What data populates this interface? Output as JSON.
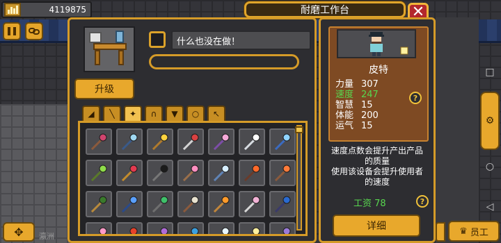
{
  "topbar": {
    "money": "4119875"
  },
  "title": "耐磨工作台",
  "icons": {
    "money": "money-building-icon",
    "pause": "pause-icon",
    "link": "chain-link-icon",
    "close": "close-icon",
    "help": "question-icon",
    "dpad": "move-arrows-icon",
    "staff": "crown-icon",
    "knob": "gear-icon"
  },
  "station": {
    "upgrade_label": "升级",
    "status_text": "什么也没在做！",
    "progress": 0
  },
  "tabs": [
    {
      "name": "tab-wedge",
      "glyph": "◢"
    },
    {
      "name": "tab-stick",
      "glyph": "╲"
    },
    {
      "name": "tab-wand",
      "glyph": "✦"
    },
    {
      "name": "tab-helmet",
      "glyph": "∩"
    },
    {
      "name": "tab-armor",
      "glyph": "▼"
    },
    {
      "name": "tab-ring",
      "glyph": "○"
    },
    {
      "name": "tab-pickaxe",
      "glyph": "↖"
    }
  ],
  "active_tab": 2,
  "items": [
    {
      "name": "red-cane-icon",
      "shaft": "#8b5a3c",
      "head": "#d0446e"
    },
    {
      "name": "crystal-wand-icon",
      "shaft": "#3a5a8a",
      "head": "#9fd8f2"
    },
    {
      "name": "gold-orb-staff-icon",
      "shaft": "#b07a2c",
      "head": "#ffd33f"
    },
    {
      "name": "red-orb-wand-icon",
      "shaft": "#d4d4d4",
      "head": "#d94141"
    },
    {
      "name": "pink-crystal-wand-icon",
      "shaft": "#7d4da8",
      "head": "#f5a9d8"
    },
    {
      "name": "silver-rod-icon",
      "shaft": "#d8dde2",
      "head": "#ffffff"
    },
    {
      "name": "blue-gem-wand-icon",
      "shaft": "#3b6bc1",
      "head": "#8fd3ff"
    },
    {
      "name": "green-leaf-staff-icon",
      "shaft": "#5a7a2a",
      "head": "#8fdc4a"
    },
    {
      "name": "ruby-star-staff-icon",
      "shaft": "#c28b2c",
      "head": "#e23a4f"
    },
    {
      "name": "black-orb-rod-icon",
      "shaft": "#777777",
      "head": "#1b1b1b"
    },
    {
      "name": "pink-heart-wand-icon",
      "shaft": "#9a6f4a",
      "head": "#ff8fc1"
    },
    {
      "name": "ice-axe-wand-icon",
      "shaft": "#5f83b5",
      "head": "#d6eeff"
    },
    {
      "name": "fire-ring-staff-icon",
      "shaft": "#6a3b2a",
      "head": "#ff6a2a"
    },
    {
      "name": "flame-mace-icon",
      "shaft": "#8b5a3c",
      "head": "#ff7b3a"
    },
    {
      "name": "thorn-staff-icon",
      "shaft": "#b88a3c",
      "head": "#3a7a2c"
    },
    {
      "name": "sapphire-rod-icon",
      "shaft": "#2a4a8a",
      "head": "#5aa0ff"
    },
    {
      "name": "emerald-mace-icon",
      "shaft": "#6f6f6f",
      "head": "#3fc06a"
    },
    {
      "name": "skull-staff-icon",
      "shaft": "#8b5a3c",
      "head": "#e9e3d0"
    },
    {
      "name": "sun-orb-staff-icon",
      "shaft": "#c1863a",
      "head": "#ff9a2a"
    },
    {
      "name": "pearl-wand-icon",
      "shaft": "#d7d7d7",
      "head": "#f2b2d6"
    },
    {
      "name": "night-orb-staff-icon",
      "shaft": "#3a3a6a",
      "head": "#2a6ad0"
    },
    {
      "name": "blossom-wand-icon",
      "shaft": "#a06a3a",
      "head": "#ff9ac8"
    },
    {
      "name": "ember-wand-icon",
      "shaft": "#7a3a2a",
      "head": "#e8412a"
    },
    {
      "name": "bat-wand-icon",
      "shaft": "#5a3a7a",
      "head": "#b06ad8"
    },
    {
      "name": "sea-orb-wand-icon",
      "shaft": "#2a5a8a",
      "head": "#3aa0e0"
    },
    {
      "name": "frost-wand-icon",
      "shaft": "#8aa8c8",
      "head": "#e8f6ff"
    },
    {
      "name": "gold-crown-staff-icon",
      "shaft": "#c8a040",
      "head": "#fff1a0"
    },
    {
      "name": "violet-rod-icon",
      "shaft": "#4a3a8a",
      "head": "#9a7ad8"
    }
  ],
  "worker": {
    "name": "皮特",
    "stats": [
      {
        "label": "力量",
        "value": "307",
        "highlight": false
      },
      {
        "label": "速度",
        "value": "247",
        "highlight": true
      },
      {
        "label": "智慧",
        "value": "15",
        "highlight": false
      },
      {
        "label": "体能",
        "value": "200",
        "highlight": false
      },
      {
        "label": "运气",
        "value": "15",
        "highlight": false
      }
    ],
    "badge": "🜲"
  },
  "description": {
    "line1": "速度点数会提升产出产品",
    "line2": "的质量",
    "line3": "使用该设备会提升使用者",
    "line4": "的速度"
  },
  "wage": {
    "label": "工资",
    "value": "78"
  },
  "detail_label": "详细",
  "staff_label": "员工",
  "faded_bottom_text": "瀛洲",
  "colors": {
    "accent": "#d59b28",
    "button": "#e8a82c",
    "highlight_green": "#58d64f",
    "close_red": "#b3282d"
  }
}
